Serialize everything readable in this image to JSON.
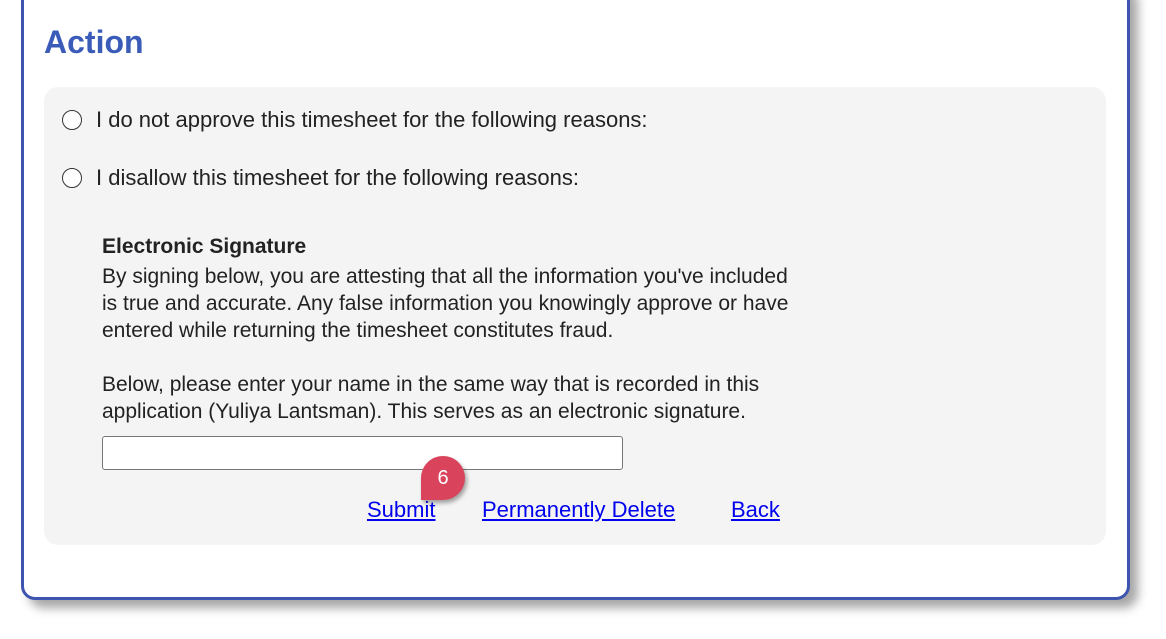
{
  "section": {
    "title": "Action"
  },
  "options": [
    {
      "label": "I do not approve this timesheet for the following reasons:"
    },
    {
      "label": "I disallow this timesheet for the following reasons:"
    }
  ],
  "signature": {
    "title": "Electronic Signature",
    "attest_lines": [
      "By signing below, you are attesting that all the information you've included",
      "is true and accurate. Any false information you knowingly approve or have",
      "entered while returning the timesheet constitutes fraud."
    ],
    "instruction_lines": [
      "Below, please enter your name in the same way that is recorded in this",
      "application (Yuliya Lantsman). This serves as an electronic signature."
    ],
    "input_value": ""
  },
  "actions": {
    "submit": "Submit",
    "delete": "Permanently Delete",
    "back": "Back"
  },
  "callout": {
    "number": "6"
  },
  "colors": {
    "border": "#3d55b0",
    "title": "#3a5bb8",
    "panel_bg": "#f4f4f4",
    "link": "#0000ee",
    "callout": "#d9435b"
  }
}
